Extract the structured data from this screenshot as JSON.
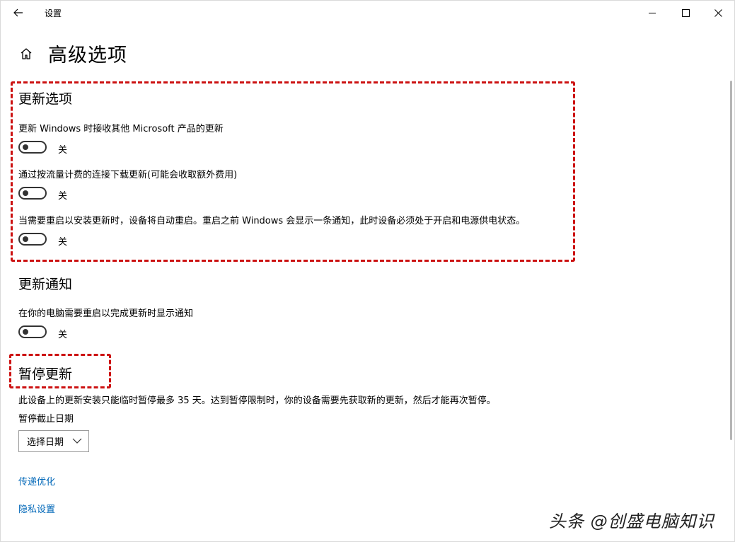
{
  "window": {
    "title": "设置"
  },
  "page": {
    "title": "高级选项"
  },
  "update_options": {
    "heading": "更新选项",
    "items": [
      {
        "label": "更新 Windows 时接收其他 Microsoft 产品的更新",
        "state": "关"
      },
      {
        "label": "通过按流量计费的连接下载更新(可能会收取额外费用)",
        "state": "关"
      },
      {
        "label": "当需要重启以安装更新时，设备将自动重启。重启之前 Windows 会显示一条通知，此时设备必须处于开启和电源供电状态。",
        "state": "关"
      }
    ]
  },
  "update_notifications": {
    "heading": "更新通知",
    "items": [
      {
        "label": "在你的电脑需要重启以完成更新时显示通知",
        "state": "关"
      }
    ]
  },
  "pause_updates": {
    "heading": "暂停更新",
    "description": "此设备上的更新安装只能临时暂停最多 35 天。达到暂停限制时，你的设备需要先获取新的更新，然后才能再次暂停。",
    "date_label": "暂停截止日期",
    "dropdown_value": "选择日期"
  },
  "links": {
    "delivery_optimization": "传递优化",
    "privacy_settings": "隐私设置"
  },
  "watermark": "头条 @创盛电脑知识",
  "colors": {
    "highlight": "#cc1111",
    "link": "#0067b8"
  }
}
